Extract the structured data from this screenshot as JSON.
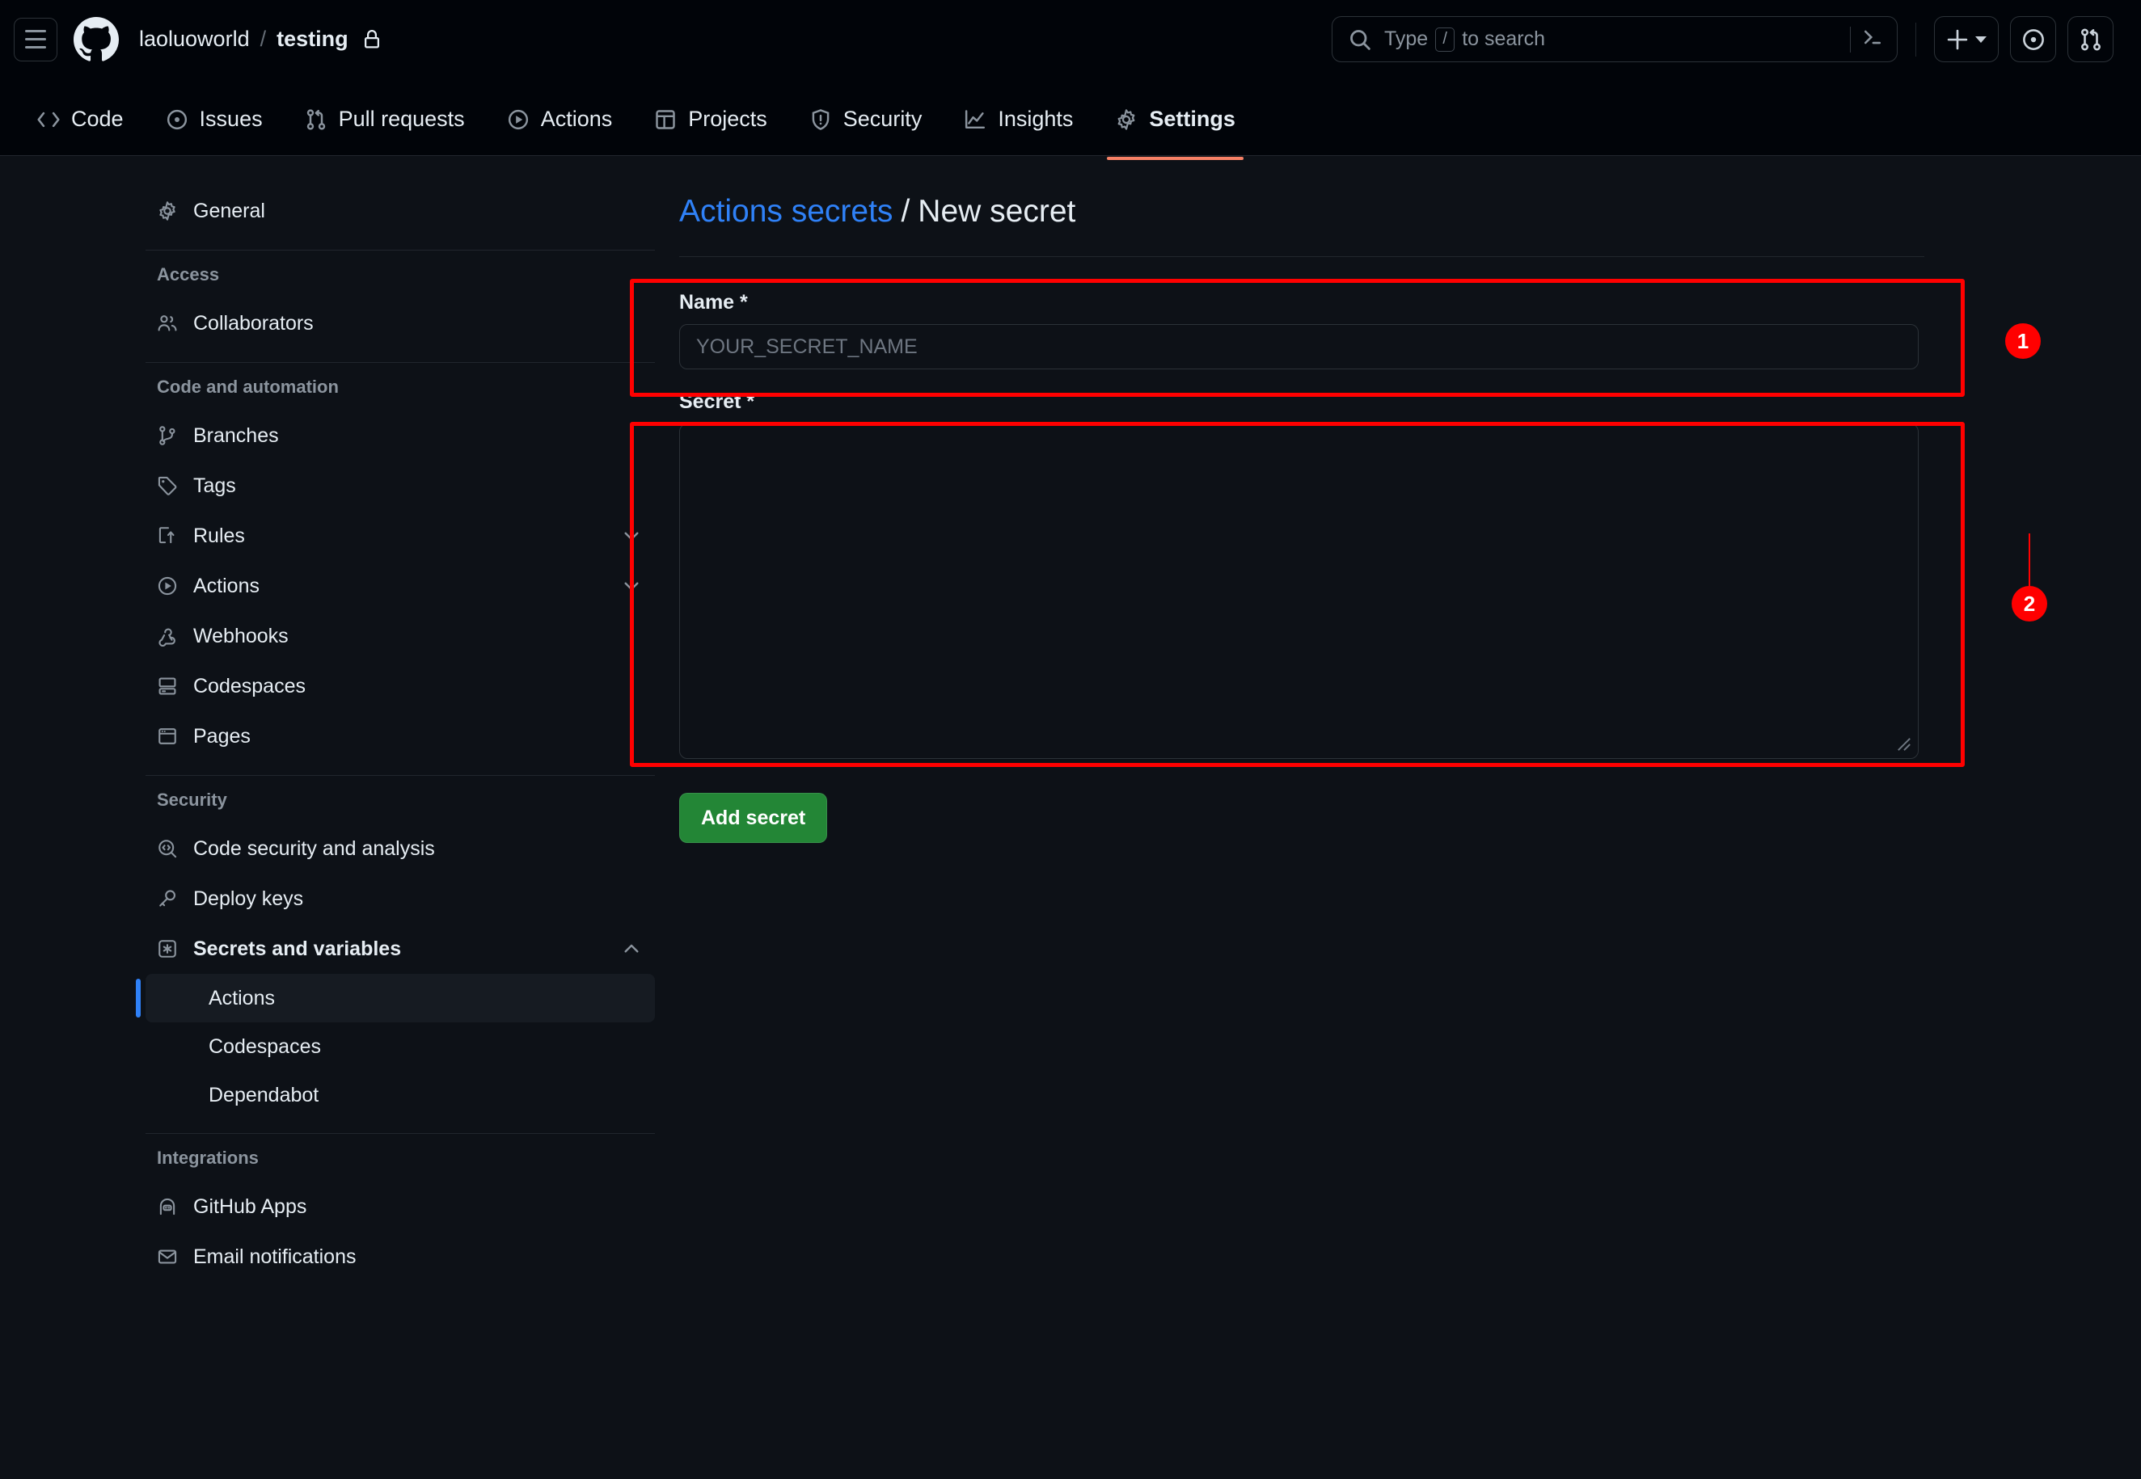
{
  "colors": {
    "background": "#0d1117",
    "header_background": "#010409",
    "accent_link": "#2f81f7",
    "active_tab_underline": "#f78166",
    "primary_button": "#238636",
    "annotation": "#ff0000",
    "active_sidebar_marker": "#2f81f7"
  },
  "header": {
    "menu_icon": "hamburger-icon",
    "logo_icon": "github-logo-icon",
    "owner": "laoluoworld",
    "separator": "/",
    "repo": "testing",
    "visibility_icon": "lock-icon",
    "search": {
      "icon": "search-icon",
      "placeholder_before": "Type",
      "placeholder_key": "/",
      "placeholder_after": "to search",
      "value": "",
      "terminal_icon": "command-palette-icon"
    },
    "actions": [
      {
        "name": "create-new-button",
        "icon": "plus-icon",
        "has_caret": true
      },
      {
        "name": "issues-button",
        "icon": "issue-opened-icon",
        "has_caret": false
      },
      {
        "name": "pull-requests-button",
        "icon": "git-pull-request-icon",
        "has_caret": false
      }
    ]
  },
  "repo_nav": {
    "tabs": [
      {
        "label": "Code",
        "icon": "code-icon",
        "active": false
      },
      {
        "label": "Issues",
        "icon": "issue-opened-icon",
        "active": false
      },
      {
        "label": "Pull requests",
        "icon": "git-pull-request-icon",
        "active": false
      },
      {
        "label": "Actions",
        "icon": "play-icon",
        "active": false
      },
      {
        "label": "Projects",
        "icon": "table-icon",
        "active": false
      },
      {
        "label": "Security",
        "icon": "shield-icon",
        "active": false
      },
      {
        "label": "Insights",
        "icon": "graph-icon",
        "active": false
      },
      {
        "label": "Settings",
        "icon": "gear-icon",
        "active": true
      }
    ]
  },
  "sidebar": {
    "general": {
      "label": "General",
      "icon": "gear-icon"
    },
    "groups": [
      {
        "title": "Access",
        "items": [
          {
            "label": "Collaborators",
            "icon": "people-icon",
            "expandable": false
          }
        ]
      },
      {
        "title": "Code and automation",
        "items": [
          {
            "label": "Branches",
            "icon": "git-branch-icon",
            "expandable": false
          },
          {
            "label": "Tags",
            "icon": "tag-icon",
            "expandable": false
          },
          {
            "label": "Rules",
            "icon": "rules-icon",
            "expandable": true,
            "expanded": false
          },
          {
            "label": "Actions",
            "icon": "play-icon",
            "expandable": true,
            "expanded": false
          },
          {
            "label": "Webhooks",
            "icon": "webhook-icon",
            "expandable": false
          },
          {
            "label": "Codespaces",
            "icon": "codespaces-icon",
            "expandable": false
          },
          {
            "label": "Pages",
            "icon": "browser-icon",
            "expandable": false
          }
        ]
      },
      {
        "title": "Security",
        "items": [
          {
            "label": "Code security and analysis",
            "icon": "codescan-icon",
            "expandable": false
          },
          {
            "label": "Deploy keys",
            "icon": "key-icon",
            "expandable": false
          },
          {
            "label": "Secrets and variables",
            "icon": "asterisk-icon",
            "expandable": true,
            "expanded": true,
            "bold": true
          }
        ],
        "subitems": [
          {
            "label": "Actions",
            "active": true
          },
          {
            "label": "Codespaces",
            "active": false
          },
          {
            "label": "Dependabot",
            "active": false
          }
        ]
      },
      {
        "title": "Integrations",
        "items": [
          {
            "label": "GitHub Apps",
            "icon": "apps-icon",
            "expandable": false
          },
          {
            "label": "Email notifications",
            "icon": "mail-icon",
            "expandable": false
          }
        ]
      }
    ]
  },
  "main": {
    "breadcrumb_link": "Actions secrets",
    "breadcrumb_separator": "/",
    "breadcrumb_current": "New secret",
    "name_field": {
      "label": "Name *",
      "placeholder": "YOUR_SECRET_NAME",
      "value": ""
    },
    "secret_field": {
      "label": "Secret *",
      "placeholder": "",
      "value": ""
    },
    "submit_label": "Add secret"
  },
  "annotations": [
    {
      "number": "1",
      "target": "name-field"
    },
    {
      "number": "2",
      "target": "secret-field"
    }
  ]
}
